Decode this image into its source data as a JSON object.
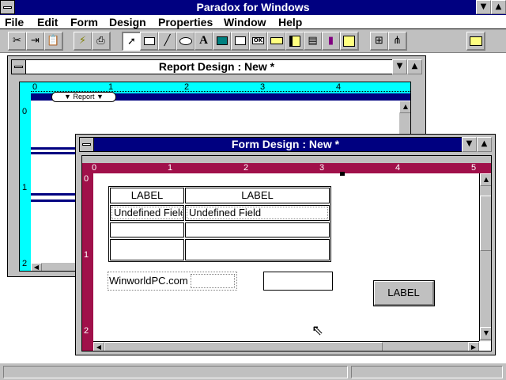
{
  "app": {
    "title": "Paradox for Windows"
  },
  "menu": {
    "items": [
      "File",
      "Edit",
      "Form",
      "Design",
      "Properties",
      "Window",
      "Help"
    ]
  },
  "toolbar": {
    "tools": [
      "cut-icon",
      "copy-to-icon",
      "paste-icon",
      "run-icon",
      "print-icon",
      "select-arrow-icon",
      "box-tool-icon",
      "line-tool-icon",
      "ellipse-tool-icon",
      "text-tool-icon",
      "graphic-tool-icon",
      "ole-tool-icon",
      "button-tool-icon",
      "field-tool-icon",
      "table-tool-icon",
      "multirecord-tool-icon",
      "chart-tool-icon",
      "crosstab-tool-icon",
      "object-tree-icon",
      "data-model-icon",
      "folder-icon"
    ],
    "text_tool_glyph": "A",
    "button_tool_label": "OK"
  },
  "report_window": {
    "title": "Report Design : New *",
    "band_label": "Report",
    "ruler_h": [
      "0",
      "1",
      "2",
      "3",
      "4"
    ],
    "ruler_v": [
      "0",
      "1",
      "2"
    ]
  },
  "form_window": {
    "title": "Form Design : New *",
    "ruler_h": [
      "0",
      "1",
      "2",
      "3",
      "4",
      "5"
    ],
    "ruler_v": [
      "0",
      "1",
      "2"
    ],
    "table": {
      "headers": [
        "LABEL",
        "LABEL"
      ],
      "first_row": [
        "Undefined Field",
        "Undefined Field"
      ]
    },
    "text_field": "WinworldPC.com",
    "button_label": "LABEL"
  },
  "colors": {
    "titlebar_active": "#000080",
    "report_ruler": "#00ffff",
    "form_ruler": "#a0104a",
    "chrome": "#c0c0c0"
  }
}
